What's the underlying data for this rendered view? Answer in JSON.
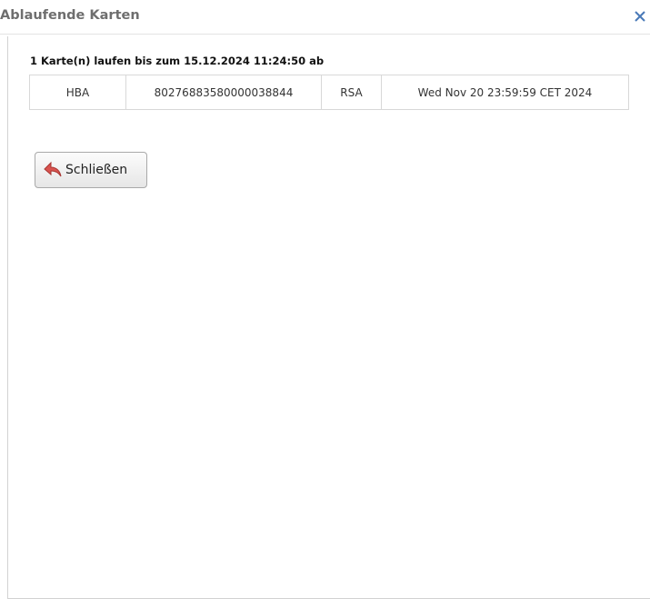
{
  "dialog": {
    "title": "Ablaufende Karten",
    "close_icon": "close-icon"
  },
  "summary": "1 Karte(n) laufen bis zum 15.12.2024 11:24:50 ab",
  "table": {
    "rows": [
      [
        "HBA",
        "80276883580000038844",
        "RSA",
        "Wed Nov 20 23:59:59 CET 2024"
      ]
    ]
  },
  "buttons": {
    "close_label": "Schließen",
    "close_icon": "undo-arrow-icon"
  },
  "colors": {
    "close_x": "#4a7ab8",
    "arrow_icon": "#d9534f"
  }
}
